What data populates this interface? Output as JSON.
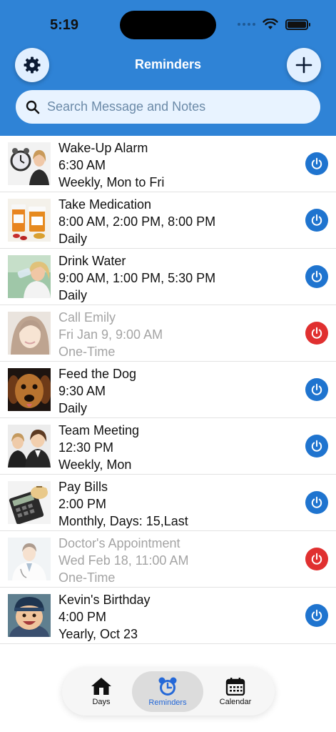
{
  "status": {
    "time": "5:19"
  },
  "header": {
    "title": "Reminders"
  },
  "search": {
    "placeholder": "Search Message and Notes"
  },
  "reminders": [
    {
      "title": "Wake-Up Alarm",
      "time": "6:30 AM",
      "repeat": "Weekly, Mon to Fri",
      "enabled": true
    },
    {
      "title": "Take Medication",
      "time": "8:00 AM, 2:00 PM, 8:00 PM",
      "repeat": "Daily",
      "enabled": true
    },
    {
      "title": "Drink Water",
      "time": "9:00 AM, 1:00 PM, 5:30 PM",
      "repeat": "Daily",
      "enabled": true
    },
    {
      "title": "Call Emily",
      "time": "Fri Jan 9, 9:00 AM",
      "repeat": "One-Time",
      "enabled": false
    },
    {
      "title": "Feed the Dog",
      "time": "9:30 AM",
      "repeat": "Daily",
      "enabled": true
    },
    {
      "title": "Team Meeting",
      "time": "12:30 PM",
      "repeat": "Weekly, Mon",
      "enabled": true
    },
    {
      "title": "Pay Bills",
      "time": "2:00 PM",
      "repeat": "Monthly, Days: 15,Last",
      "enabled": true
    },
    {
      "title": "Doctor's Appointment",
      "time": "Wed Feb 18, 11:00 AM",
      "repeat": "One-Time",
      "enabled": false
    },
    {
      "title": "Kevin's Birthday",
      "time": "4:00 PM",
      "repeat": "Yearly, Oct 23",
      "enabled": true
    }
  ],
  "tabs": [
    {
      "label": "Days",
      "icon": "house-icon"
    },
    {
      "label": "Reminders",
      "icon": "alarm-clock-icon",
      "selected": true
    },
    {
      "label": "Calendar",
      "icon": "calendar-icon"
    }
  ],
  "colors": {
    "header": "#2f83d6",
    "enabled": "#1f74cf",
    "disabled": "#e03030",
    "selected_tab": "#2468d8"
  }
}
